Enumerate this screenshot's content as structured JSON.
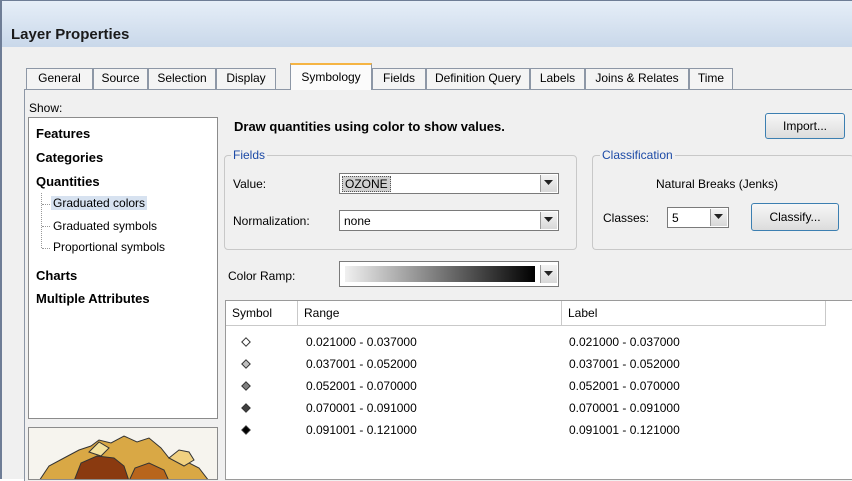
{
  "window": {
    "title": "Layer Properties"
  },
  "tabs": [
    {
      "label": "General",
      "active": false
    },
    {
      "label": "Source",
      "active": false
    },
    {
      "label": "Selection",
      "active": false
    },
    {
      "label": "Display",
      "active": false
    },
    {
      "label": "Symbology",
      "active": true
    },
    {
      "label": "Fields",
      "active": false
    },
    {
      "label": "Definition Query",
      "active": false
    },
    {
      "label": "Labels",
      "active": false
    },
    {
      "label": "Joins & Relates",
      "active": false
    },
    {
      "label": "Time",
      "active": false
    }
  ],
  "show": {
    "label": "Show:",
    "items": [
      "Features",
      "Categories",
      "Quantities",
      "Charts",
      "Multiple Attributes"
    ],
    "sub_items": [
      "Graduated colors",
      "Graduated symbols",
      "Proportional symbols"
    ],
    "selected": "Graduated colors"
  },
  "description": "Draw quantities using color to show values.",
  "import_button": "Import...",
  "fields": {
    "legend": "Fields",
    "value_label": "Value:",
    "value": "OZONE",
    "normalization_label": "Normalization:",
    "normalization": "none"
  },
  "classification": {
    "legend": "Classification",
    "method": "Natural Breaks (Jenks)",
    "classes_label": "Classes:",
    "classes": "5",
    "classify_button": "Classify..."
  },
  "color_ramp": {
    "label": "Color Ramp:",
    "start_color": "#f0f0f0",
    "end_color": "#000000"
  },
  "table": {
    "headers": [
      "Symbol",
      "Range",
      "Label"
    ],
    "rows": [
      {
        "range": "0.021000 - 0.037000",
        "label": "0.021000 - 0.037000",
        "color": "#ffffff"
      },
      {
        "range": "0.037001 - 0.052000",
        "label": "0.037001 - 0.052000",
        "color": "#bfbfbf"
      },
      {
        "range": "0.052001 - 0.070000",
        "label": "0.052001 - 0.070000",
        "color": "#808080"
      },
      {
        "range": "0.070001 - 0.091000",
        "label": "0.070001 - 0.091000",
        "color": "#404040"
      },
      {
        "range": "0.091001 - 0.121000",
        "label": "0.091001 - 0.121000",
        "color": "#000000"
      }
    ]
  }
}
